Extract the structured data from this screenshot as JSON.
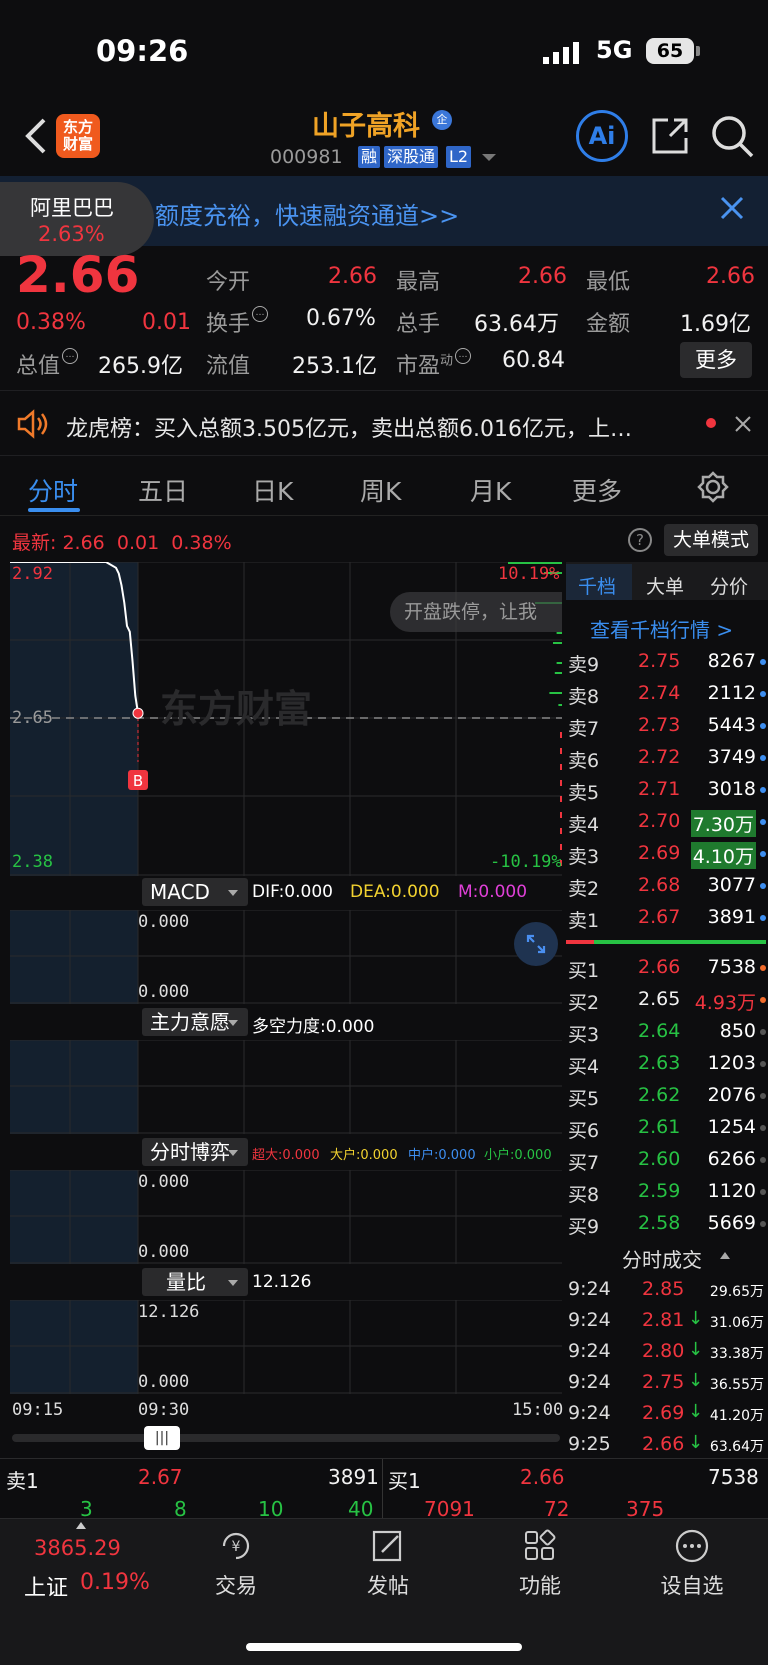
{
  "status": {
    "time": "09:26",
    "network": "5G",
    "battery": "65"
  },
  "header": {
    "logo": "东方\n财富",
    "name": "山子高科",
    "code": "000981",
    "tags": [
      "融",
      "深股通",
      "L2"
    ],
    "ai": "Ai",
    "badge": "企"
  },
  "banner": {
    "text": "额度充裕，快速融资通道>>",
    "related_name": "阿里巴巴",
    "related_pct": "2.63%"
  },
  "quote": {
    "price": "2.66",
    "pct": "0.38%",
    "chg": "0.01",
    "open_label": "今开",
    "open": "2.66",
    "high_label": "最高",
    "high": "2.66",
    "low_label": "最低",
    "low": "2.66",
    "turnover_label": "换手",
    "turnover": "0.67%",
    "vol_label": "总手",
    "vol": "63.64万",
    "amount_label": "金额",
    "amount": "1.69亿",
    "mcap_label": "总值",
    "mcap": "265.9亿",
    "float_label": "流值",
    "float": "253.1亿",
    "pe_label": "市盈",
    "pe_sup": "动",
    "pe": "60.84",
    "more": "更多"
  },
  "news": {
    "text": "龙虎榜：买入总额3.505亿元，卖出总额6.016亿元，上…"
  },
  "tabs": [
    "分时",
    "五日",
    "日K",
    "周K",
    "月K",
    "更多"
  ],
  "latest": {
    "label": "最新:",
    "price": "2.66",
    "chg": "0.01",
    "pct": "0.38%",
    "big_mode": "大单模式"
  },
  "chart": {
    "y_top": "2.92",
    "y_mid": "2.65",
    "y_bot": "2.38",
    "pct_top": "10.19%",
    "pct_bot": "-10.19%",
    "toast": "开盘跌停，让我",
    "watermark": "东方财富",
    "marker": "B",
    "times": [
      "09:15",
      "09:30",
      "15:00"
    ]
  },
  "chart_data": {
    "type": "line",
    "title": "",
    "x": [
      "09:15",
      "09:30",
      "15:00"
    ],
    "prices": [
      2.92,
      2.92,
      2.92,
      2.92,
      2.91,
      2.9,
      2.88,
      2.85,
      2.81,
      2.8,
      2.75,
      2.69,
      2.66
    ],
    "ylim": [
      2.38,
      2.92
    ],
    "prev_close": 2.65
  },
  "indicators": {
    "macd": {
      "name": "MACD",
      "dif": "DIF:0.000",
      "dea": "DEA:0.000",
      "m": "M:0.000",
      "v1": "0.000",
      "v2": "0.000"
    },
    "intent": {
      "name": "主力意愿",
      "val": "多空力度:0.000"
    },
    "game": {
      "name": "分时博弈",
      "cd": "超大:0.000",
      "dh": "大户:0.000",
      "zh": "中户:0.000",
      "xh": "小户:0.000",
      "v1": "0.000",
      "v2": "0.000"
    },
    "ratio": {
      "name": "量比",
      "val": "12.126",
      "v1": "12.126",
      "v2": "0.000"
    }
  },
  "orderbook": {
    "tabs": [
      "千档",
      "大单",
      "分价"
    ],
    "link": "查看千档行情 >",
    "asks": [
      [
        "卖9",
        "2.75",
        "8267"
      ],
      [
        "卖8",
        "2.74",
        "2112"
      ],
      [
        "卖7",
        "2.73",
        "5443"
      ],
      [
        "卖6",
        "2.72",
        "3749"
      ],
      [
        "卖5",
        "2.71",
        "3018"
      ],
      [
        "卖4",
        "2.70",
        "7.30万"
      ],
      [
        "卖3",
        "2.69",
        "4.10万"
      ],
      [
        "卖2",
        "2.68",
        "3077"
      ],
      [
        "卖1",
        "2.67",
        "3891"
      ]
    ],
    "bids": [
      [
        "买1",
        "2.66",
        "7538"
      ],
      [
        "买2",
        "2.65",
        "4.93万"
      ],
      [
        "买3",
        "2.64",
        "850"
      ],
      [
        "买4",
        "2.63",
        "1203"
      ],
      [
        "买5",
        "2.62",
        "2076"
      ],
      [
        "买6",
        "2.61",
        "1254"
      ],
      [
        "买7",
        "2.60",
        "6266"
      ],
      [
        "买8",
        "2.59",
        "1120"
      ],
      [
        "买9",
        "2.58",
        "5669"
      ]
    ]
  },
  "trades": {
    "title": "分时成交",
    "rows": [
      [
        "9:24",
        "2.85",
        "29.65万"
      ],
      [
        "9:24",
        "2.81",
        "31.06万"
      ],
      [
        "9:24",
        "2.80",
        "33.38万"
      ],
      [
        "9:24",
        "2.75",
        "36.55万"
      ],
      [
        "9:24",
        "2.69",
        "41.20万"
      ],
      [
        "9:25",
        "2.66",
        "63.64万"
      ]
    ]
  },
  "bottom": {
    "ask_label": "卖1",
    "ask_price": "2.67",
    "ask_vol": "3891",
    "bid_label": "买1",
    "bid_price": "2.66",
    "bid_vol": "7538",
    "nums_left": [
      "3",
      "8",
      "10",
      "40"
    ],
    "nums_right": [
      "7091",
      "72",
      "375"
    ]
  },
  "dock": {
    "index_val": "3865.29",
    "index_name": "上证",
    "index_pct": "0.19%",
    "items": [
      "交易",
      "发帖",
      "功能",
      "设自选"
    ]
  }
}
